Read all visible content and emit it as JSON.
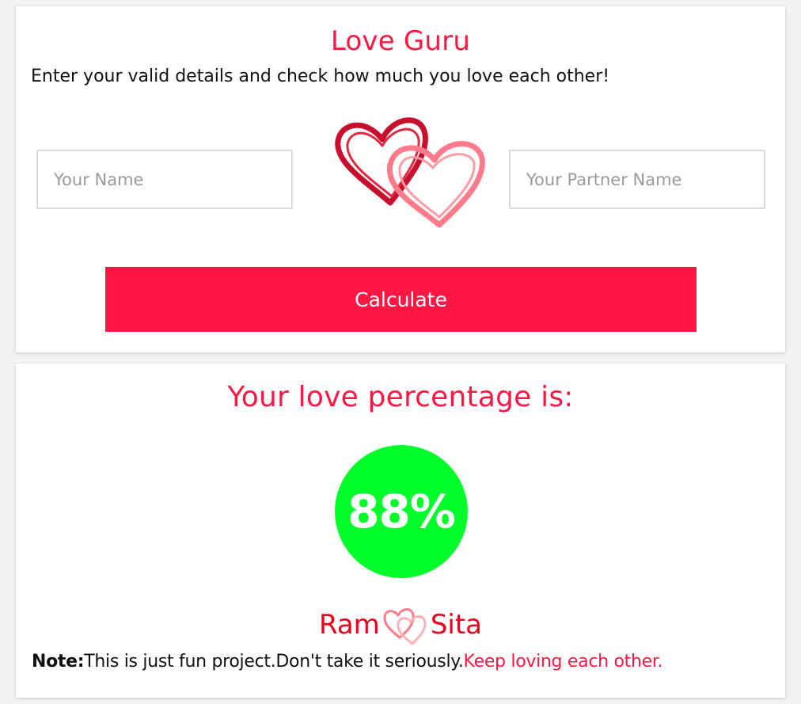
{
  "header": {
    "title": "Love Guru",
    "subtitle": "Enter your valid details and check how much you love each other!"
  },
  "form": {
    "your_name": {
      "value": "",
      "placeholder": "Your Name"
    },
    "partner_name": {
      "value": "",
      "placeholder": "Your Partner Name"
    },
    "calculate_label": "Calculate"
  },
  "result": {
    "heading": "Your love percentage is:",
    "percentage": "88%",
    "name_a": "Ram",
    "name_b": "Sita"
  },
  "note": {
    "label": "Note:",
    "text": "This is just fun project.Don't take it seriously.",
    "highlight": "Keep loving each other."
  },
  "colors": {
    "accent": "#ff1744",
    "percent_circle": "#00ff2a",
    "heart_dark": "#c8102e",
    "heart_light": "#ff7a8a"
  },
  "icons": {
    "logo": "double-hearts-icon",
    "couple": "hearts-icon"
  }
}
